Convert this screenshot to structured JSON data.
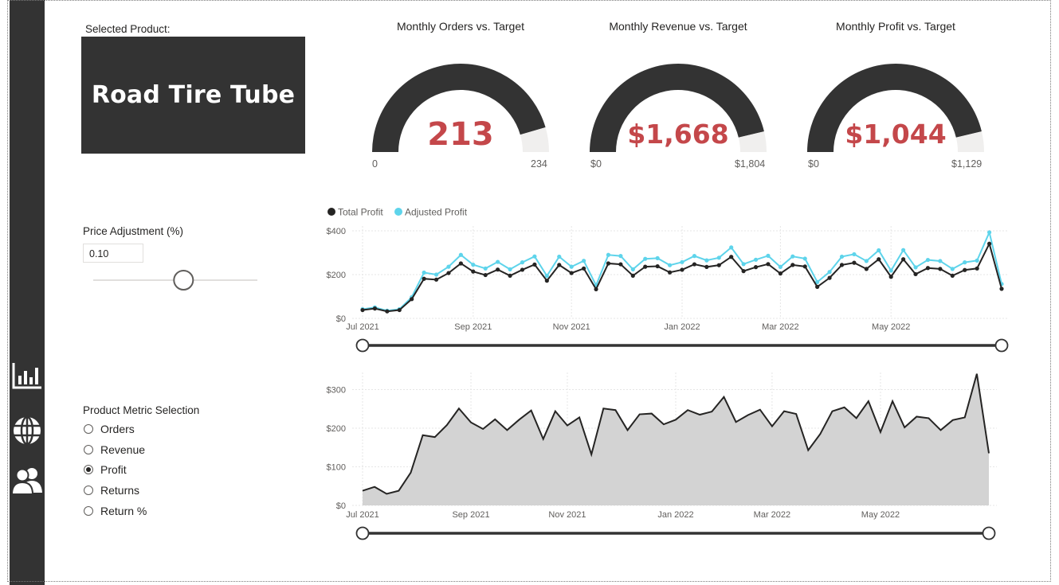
{
  "nav": {
    "icons": [
      "bar-chart-icon",
      "globe-icon",
      "users-icon"
    ]
  },
  "product": {
    "label": "Selected Product:",
    "name": "Road Tire Tube"
  },
  "gauges": [
    {
      "title": "Monthly Orders vs. Target",
      "value": "213",
      "min": "0",
      "max": "234",
      "fraction": 0.91
    },
    {
      "title": "Monthly Revenue vs. Target",
      "value": "$1,668",
      "min": "$0",
      "max": "$1,804",
      "fraction": 0.925
    },
    {
      "title": "Monthly Profit vs. Target",
      "value": "$1,044",
      "min": "$0",
      "max": "$1,129",
      "fraction": 0.925
    }
  ],
  "price": {
    "label": "Price Adjustment (%)",
    "value": "0.10",
    "slider_fraction": 0.55
  },
  "metrics": {
    "label": "Product Metric Selection",
    "options": [
      "Orders",
      "Revenue",
      "Profit",
      "Returns",
      "Return %"
    ],
    "selected": "Profit"
  },
  "colors": {
    "dark": "#333333",
    "accent": "#c4474a",
    "adjusted": "#5ed4eb",
    "area": "#d3d3d3"
  },
  "chart_data": [
    {
      "type": "line",
      "legend": {
        "position": "top-left",
        "entries": [
          "Total Profit",
          "Adjusted Profit"
        ]
      },
      "x_ticks": [
        "Jul 2021",
        "Sep 2021",
        "Nov 2021",
        "Jan 2022",
        "Mar 2022",
        "May 2022"
      ],
      "y_ticks": [
        "$0",
        "$200",
        "$400"
      ],
      "ylim": [
        0,
        400
      ],
      "grid": true,
      "series": [
        {
          "name": "Total Profit",
          "color": "#252423",
          "values": [
            38,
            45,
            32,
            38,
            88,
            181,
            177,
            207,
            251,
            214,
            198,
            223,
            195,
            222,
            246,
            172,
            244,
            207,
            228,
            133,
            251,
            247,
            195,
            236,
            238,
            210,
            222,
            247,
            235,
            243,
            281,
            216,
            234,
            248,
            205,
            244,
            237,
            144,
            185,
            244,
            254,
            226,
            270,
            190,
            270,
            202,
            230,
            226,
            195,
            221,
            228,
            341,
            135
          ]
        },
        {
          "name": "Adjusted Profit",
          "color": "#5ed4eb",
          "values": [
            42,
            50,
            35,
            42,
            97,
            209,
            200,
            236,
            290,
            245,
            228,
            258,
            224,
            256,
            283,
            194,
            282,
            236,
            263,
            151,
            290,
            285,
            224,
            272,
            275,
            243,
            257,
            285,
            265,
            277,
            324,
            248,
            268,
            286,
            235,
            283,
            273,
            166,
            212,
            282,
            293,
            262,
            311,
            218,
            312,
            233,
            267,
            262,
            226,
            256,
            264,
            393,
            157
          ]
        }
      ]
    },
    {
      "type": "area",
      "x_ticks": [
        "Jul 2021",
        "Sep 2021",
        "Nov 2021",
        "Jan 2022",
        "Mar 2022",
        "May 2022"
      ],
      "y_ticks": [
        "$0",
        "$100",
        "$200",
        "$300"
      ],
      "ylim": [
        0,
        340
      ],
      "grid": true,
      "series": [
        {
          "name": "Profit",
          "color": "#252423",
          "values": [
            38,
            48,
            30,
            38,
            85,
            182,
            177,
            208,
            251,
            215,
            198,
            223,
            195,
            222,
            246,
            172,
            244,
            207,
            228,
            132,
            251,
            247,
            195,
            236,
            238,
            210,
            222,
            247,
            235,
            243,
            281,
            216,
            234,
            248,
            205,
            244,
            237,
            143,
            185,
            244,
            254,
            226,
            270,
            190,
            270,
            202,
            230,
            226,
            195,
            221,
            228,
            341,
            135
          ]
        }
      ]
    }
  ]
}
